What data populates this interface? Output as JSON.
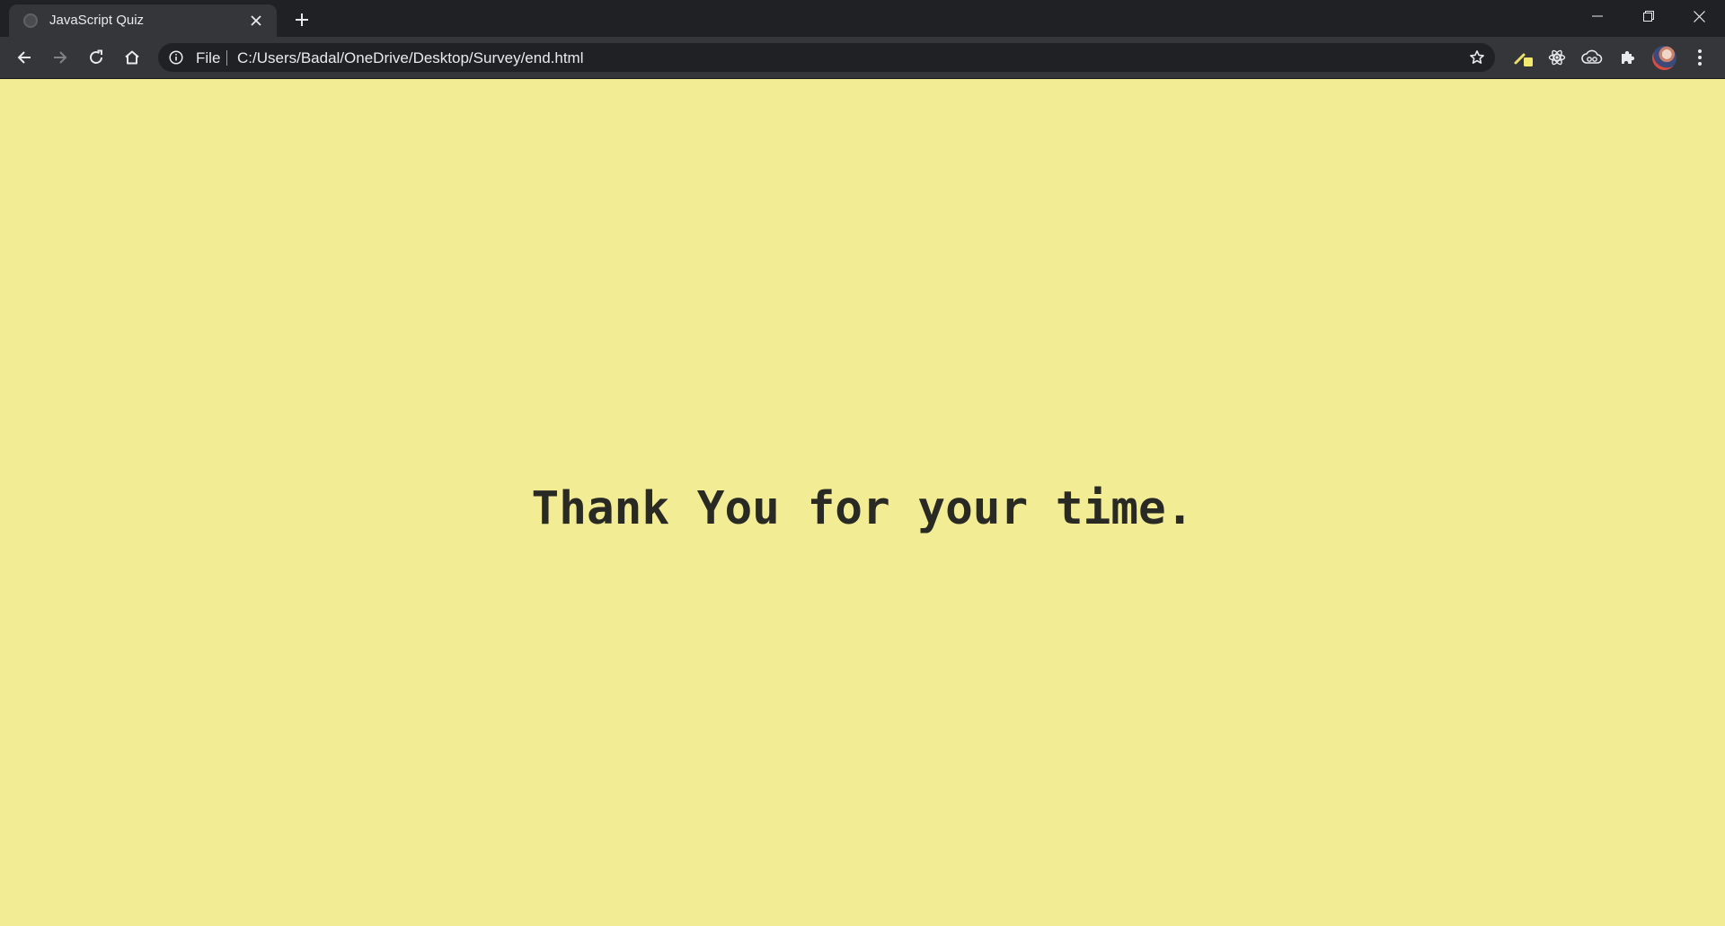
{
  "browser": {
    "tab": {
      "title": "JavaScript Quiz",
      "favicon_icon": "globe-icon",
      "close_icon": "close-icon"
    },
    "new_tab_icon": "plus-icon",
    "window_controls": [
      "minimize-icon",
      "restore-icon",
      "close-icon"
    ],
    "toolbar": {
      "back_icon": "arrow-left-icon",
      "forward_icon": "arrow-right-icon",
      "reload_icon": "reload-icon",
      "home_icon": "home-icon"
    },
    "omnibox": {
      "info_icon": "info-icon",
      "scheme": "File",
      "url": "C:/Users/Badal/OneDrive/Desktop/Survey/end.html",
      "bookmark_icon": "star-icon"
    },
    "extensions": [
      "highlighter-extension-icon",
      "react-atom-icon",
      "cloud-extension-icon",
      "puzzle-icon"
    ],
    "profile_icon": "avatar",
    "menu_icon": "kebab-menu-icon"
  },
  "page": {
    "heading": "Thank You for your time.",
    "background_color": "#f2ec94",
    "text_color": "#2a2a24"
  }
}
